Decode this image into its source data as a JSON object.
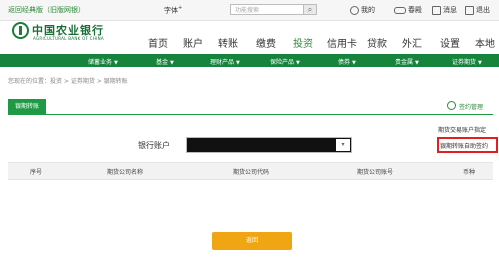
{
  "topbar": {
    "classic_link": "返回经典版（旧版网银）",
    "font_label": "字体",
    "search_placeholder": "功能搜索",
    "search_btn": "⌕",
    "tools": [
      {
        "icon": "user-icon",
        "label": "我的"
      },
      {
        "icon": "glasses-icon",
        "label": "春殿"
      },
      {
        "icon": "message-icon",
        "label": "消息"
      },
      {
        "icon": "exit-icon",
        "label": "退出"
      }
    ]
  },
  "header": {
    "logo_cn": "中国农业银行",
    "logo_en": "AGRICULTURAL BANK OF CHINA",
    "nav": [
      "首页",
      "账户",
      "转账",
      "缴费",
      "投资",
      "信用卡",
      "贷款",
      "外汇",
      "设置",
      "本地"
    ],
    "active_nav": "投资"
  },
  "menubar": [
    "储蓄业务",
    "基金",
    "理财产品",
    "保险产品",
    "债券",
    "贵金属",
    "证券期货"
  ],
  "breadcrumb": "您现在的位置：投资 > 证券期货 > 银期转账",
  "tab": {
    "label": "银期转账",
    "manage_label": "签约管理"
  },
  "account": {
    "label": "银行账户",
    "arrow": "▾"
  },
  "links": {
    "query": "期货交易账户指定",
    "sign": "银期转账自助签约"
  },
  "table": {
    "headers": [
      "序号",
      "期货公司名称",
      "期货公司代码",
      "期货公司账号",
      "币种"
    ]
  },
  "return_button": "返回",
  "colors": {
    "brand_green": "#1e9a45",
    "menubar_green": "#16843d",
    "highlight_red": "#e21f1f",
    "button_orange": "#f0a512"
  }
}
